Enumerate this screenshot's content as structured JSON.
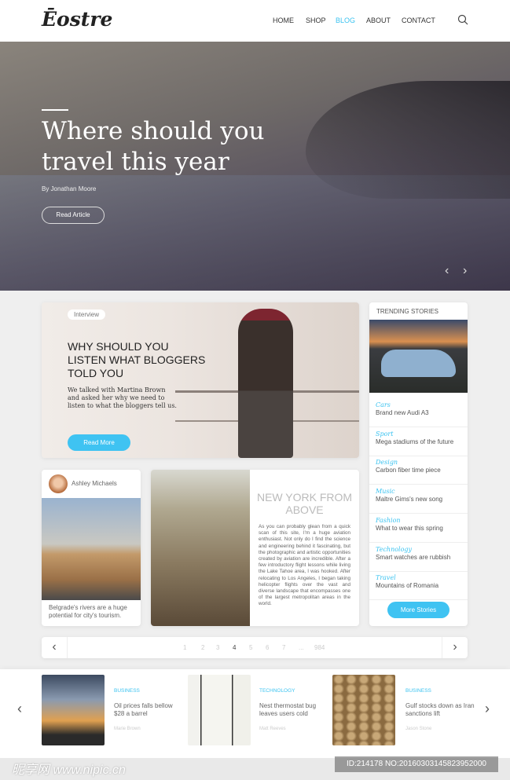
{
  "header": {
    "logo": "Ēostre",
    "nav": [
      "HOME",
      "SHOP",
      "BLOG",
      "ABOUT",
      "CONTACT"
    ],
    "active": "BLOG",
    "search_icon": "search-icon"
  },
  "hero": {
    "title": "Where should you travel this year",
    "byline": "By Jonathan Moore",
    "button": "Read Article",
    "prev": "‹",
    "next": "›"
  },
  "featured": {
    "badge": "Interview",
    "title": "WHY SHOULD YOU LISTEN  WHAT BLOGGERS TOLD YOU",
    "description": "We talked with Martina Brown and asked her why we need to listen to what the bloggers tell us.",
    "button": "Read More"
  },
  "trending": {
    "heading": "TRENDING STORIES",
    "items": [
      {
        "category": "Cars",
        "title": "Brand new Audi A3"
      },
      {
        "category": "Sport",
        "title": "Mega stadiums of the future"
      },
      {
        "category": "Design",
        "title": "Carbon fiber time piece"
      },
      {
        "category": "Music",
        "title": "Maltre Gims's new song"
      },
      {
        "category": "Fashion",
        "title": "What to wear this spring"
      },
      {
        "category": "Technology",
        "title": "Smart watches are rubbish"
      },
      {
        "category": "Travel",
        "title": "Mountains of Romania"
      }
    ],
    "button": "More Stories"
  },
  "author_card": {
    "name": "Ashley Michaels",
    "caption": "Belgrade's rivers are a huge potential for city's tourism."
  },
  "ny_card": {
    "title": "NEW YORK FROM ABOVE",
    "text": "As you can probably glean from a quick scan of this site, I'm a huge aviation enthusiast. Not only do I find the science and engineering behind it fascinating, but the photographic and artistic opportunities created by aviation are incredible. After a few introductory flight lessons while living the Lake Tahoe area, I was hooked. After relocating to Los Angeles, I began taking helicopter flights over the vast and diverse landscape that encompasses one of the largest metropolitan areas in the world."
  },
  "pagination": {
    "pages": [
      "1",
      "2",
      "3",
      "4",
      "5",
      "6",
      "7",
      "...",
      "984"
    ],
    "current": "4",
    "prev": "‹",
    "next": "›"
  },
  "strip": {
    "prev": "‹",
    "next": "›",
    "items": [
      {
        "category": "BUSINESS",
        "title": "Oil prices falls bellow $28 a barrel",
        "author": "Marie Brown"
      },
      {
        "category": "TECHNOLOGY",
        "title": "Nest thermostat bug leaves users cold",
        "author": "Matt Reeves"
      },
      {
        "category": "BUSINESS",
        "title": "Gulf stocks down as Iran sanctions lift",
        "author": "Jason Stone"
      }
    ]
  },
  "watermark": {
    "site": "昵享网 www.nipic.cn",
    "id": "ID:214178 NO:20160303145823952000"
  },
  "colors": {
    "accent": "#3cc3f0"
  }
}
